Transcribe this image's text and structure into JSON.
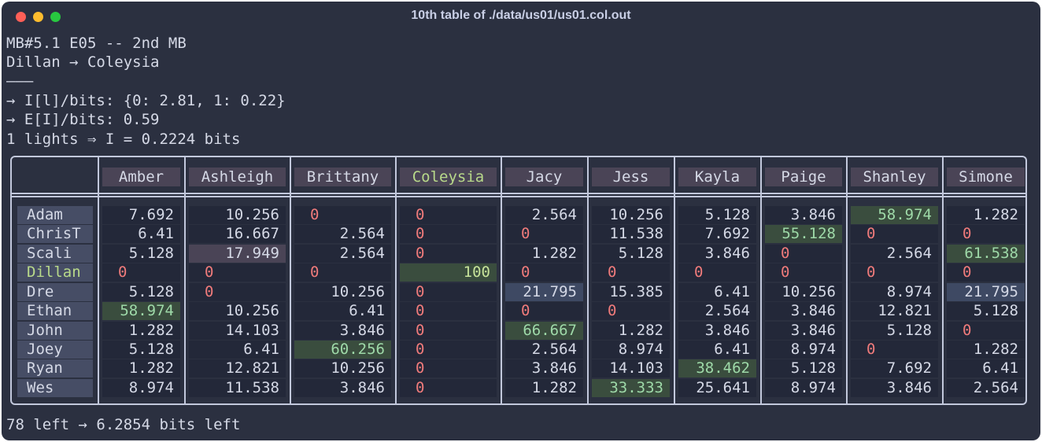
{
  "window": {
    "title": "10th table of ./data/us01/us01.col.out"
  },
  "header_lines": [
    "MB#5.1 E05 -- 2nd MB",
    "Dillan → Coleysia",
    "———",
    "→ I[l]/bits: {0: 2.81, 1: 0.22}",
    "→ E[I]/bits: 0.59",
    "1 lights ⇒ I = 0.2224 bits"
  ],
  "table": {
    "columns": [
      "Amber",
      "Ashleigh",
      "Brittany",
      "Coleysia",
      "Jacy",
      "Jess",
      "Kayla",
      "Paige",
      "Shanley",
      "Simone"
    ],
    "highlight_column": "Coleysia",
    "highlight_row": "Dillan",
    "rows": [
      {
        "name": "Adam",
        "cells": [
          "7.692",
          "10.256",
          "0",
          "0",
          "2.564",
          "10.256",
          "5.128",
          "3.846",
          "58.974",
          "1.282"
        ]
      },
      {
        "name": "ChrisT",
        "cells": [
          "6.41",
          "16.667",
          "2.564",
          "0",
          "0",
          "11.538",
          "7.692",
          "55.128",
          "0",
          "0"
        ]
      },
      {
        "name": "Scali",
        "cells": [
          "5.128",
          "17.949",
          "2.564",
          "0",
          "1.282",
          "5.128",
          "3.846",
          "0",
          "2.564",
          "61.538"
        ]
      },
      {
        "name": "Dillan",
        "cells": [
          "0",
          "0",
          "0",
          "100",
          "0",
          "0",
          "0",
          "0",
          "0",
          "0"
        ]
      },
      {
        "name": "Dre",
        "cells": [
          "5.128",
          "0",
          "10.256",
          "0",
          "21.795",
          "15.385",
          "6.41",
          "10.256",
          "8.974",
          "21.795"
        ]
      },
      {
        "name": "Ethan",
        "cells": [
          "58.974",
          "10.256",
          "6.41",
          "0",
          "0",
          "0",
          "2.564",
          "3.846",
          "12.821",
          "5.128"
        ]
      },
      {
        "name": "John",
        "cells": [
          "1.282",
          "14.103",
          "3.846",
          "0",
          "66.667",
          "1.282",
          "3.846",
          "3.846",
          "5.128",
          "0"
        ]
      },
      {
        "name": "Joey",
        "cells": [
          "5.128",
          "6.41",
          "60.256",
          "0",
          "2.564",
          "8.974",
          "6.41",
          "8.974",
          "0",
          "1.282"
        ]
      },
      {
        "name": "Ryan",
        "cells": [
          "1.282",
          "12.821",
          "10.256",
          "0",
          "3.846",
          "14.103",
          "38.462",
          "5.128",
          "7.692",
          "6.41"
        ]
      },
      {
        "name": "Wes",
        "cells": [
          "8.974",
          "11.538",
          "3.846",
          "0",
          "1.282",
          "33.333",
          "25.641",
          "8.974",
          "3.846",
          "2.564"
        ]
      }
    ],
    "cell_styles": {
      "0,8": "g",
      "1,7": "g",
      "2,1": "p",
      "2,9": "g",
      "3,3": "g bright",
      "4,4": "b",
      "4,9": "b",
      "5,0": "g",
      "6,4": "g",
      "7,2": "g",
      "8,6": "g",
      "9,5": "g"
    }
  },
  "footer": "78 left → 6.2854 bits left"
}
